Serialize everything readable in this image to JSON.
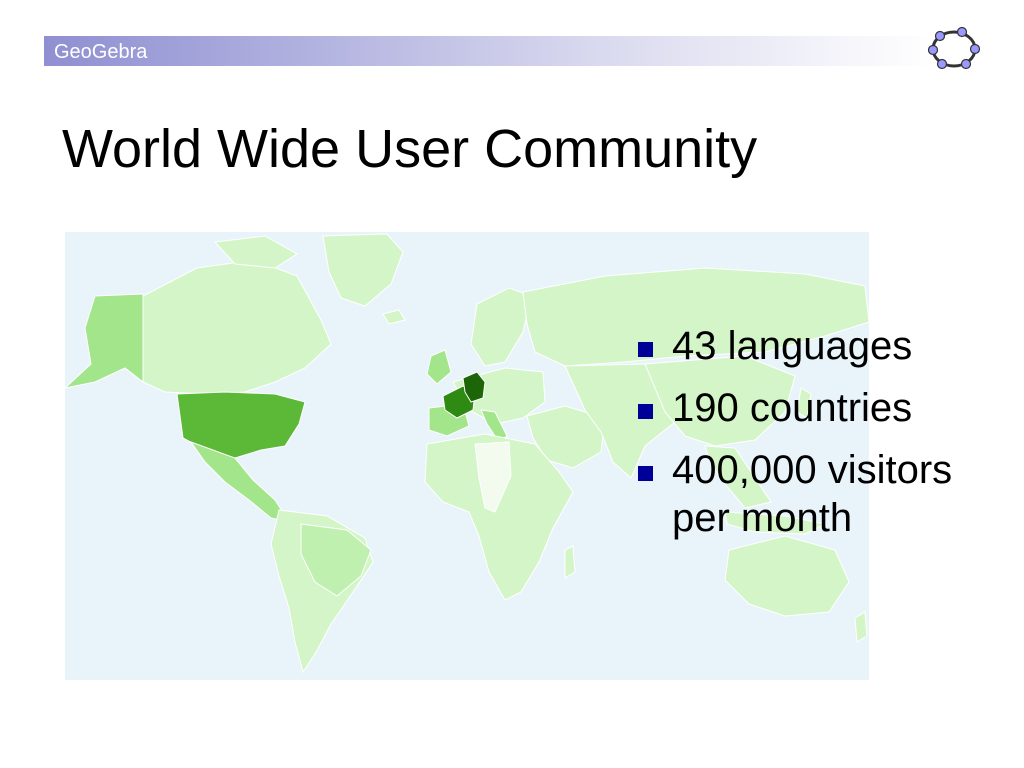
{
  "header": {
    "brand_label": "GeoGebra",
    "band_color": "#8f8fd2"
  },
  "logo": {
    "icon": "geogebra-logo-icon",
    "ring_color": "#333333",
    "node_color": "#9999ff"
  },
  "title": "World Wide User Community",
  "map": {
    "icon": "world-map-visitors",
    "ocean_color": "#e8f4fa",
    "land_color": "#d3f5c7",
    "medium_color": "#a3e58a",
    "high_color": "#5cb837",
    "top_colors": [
      "#2e8a12",
      "#1c6608"
    ]
  },
  "bullets": [
    {
      "text": "43 languages"
    },
    {
      "text": "190 countries"
    },
    {
      "text": "400,000 visitors per month"
    }
  ],
  "bullet_color": "#000099"
}
